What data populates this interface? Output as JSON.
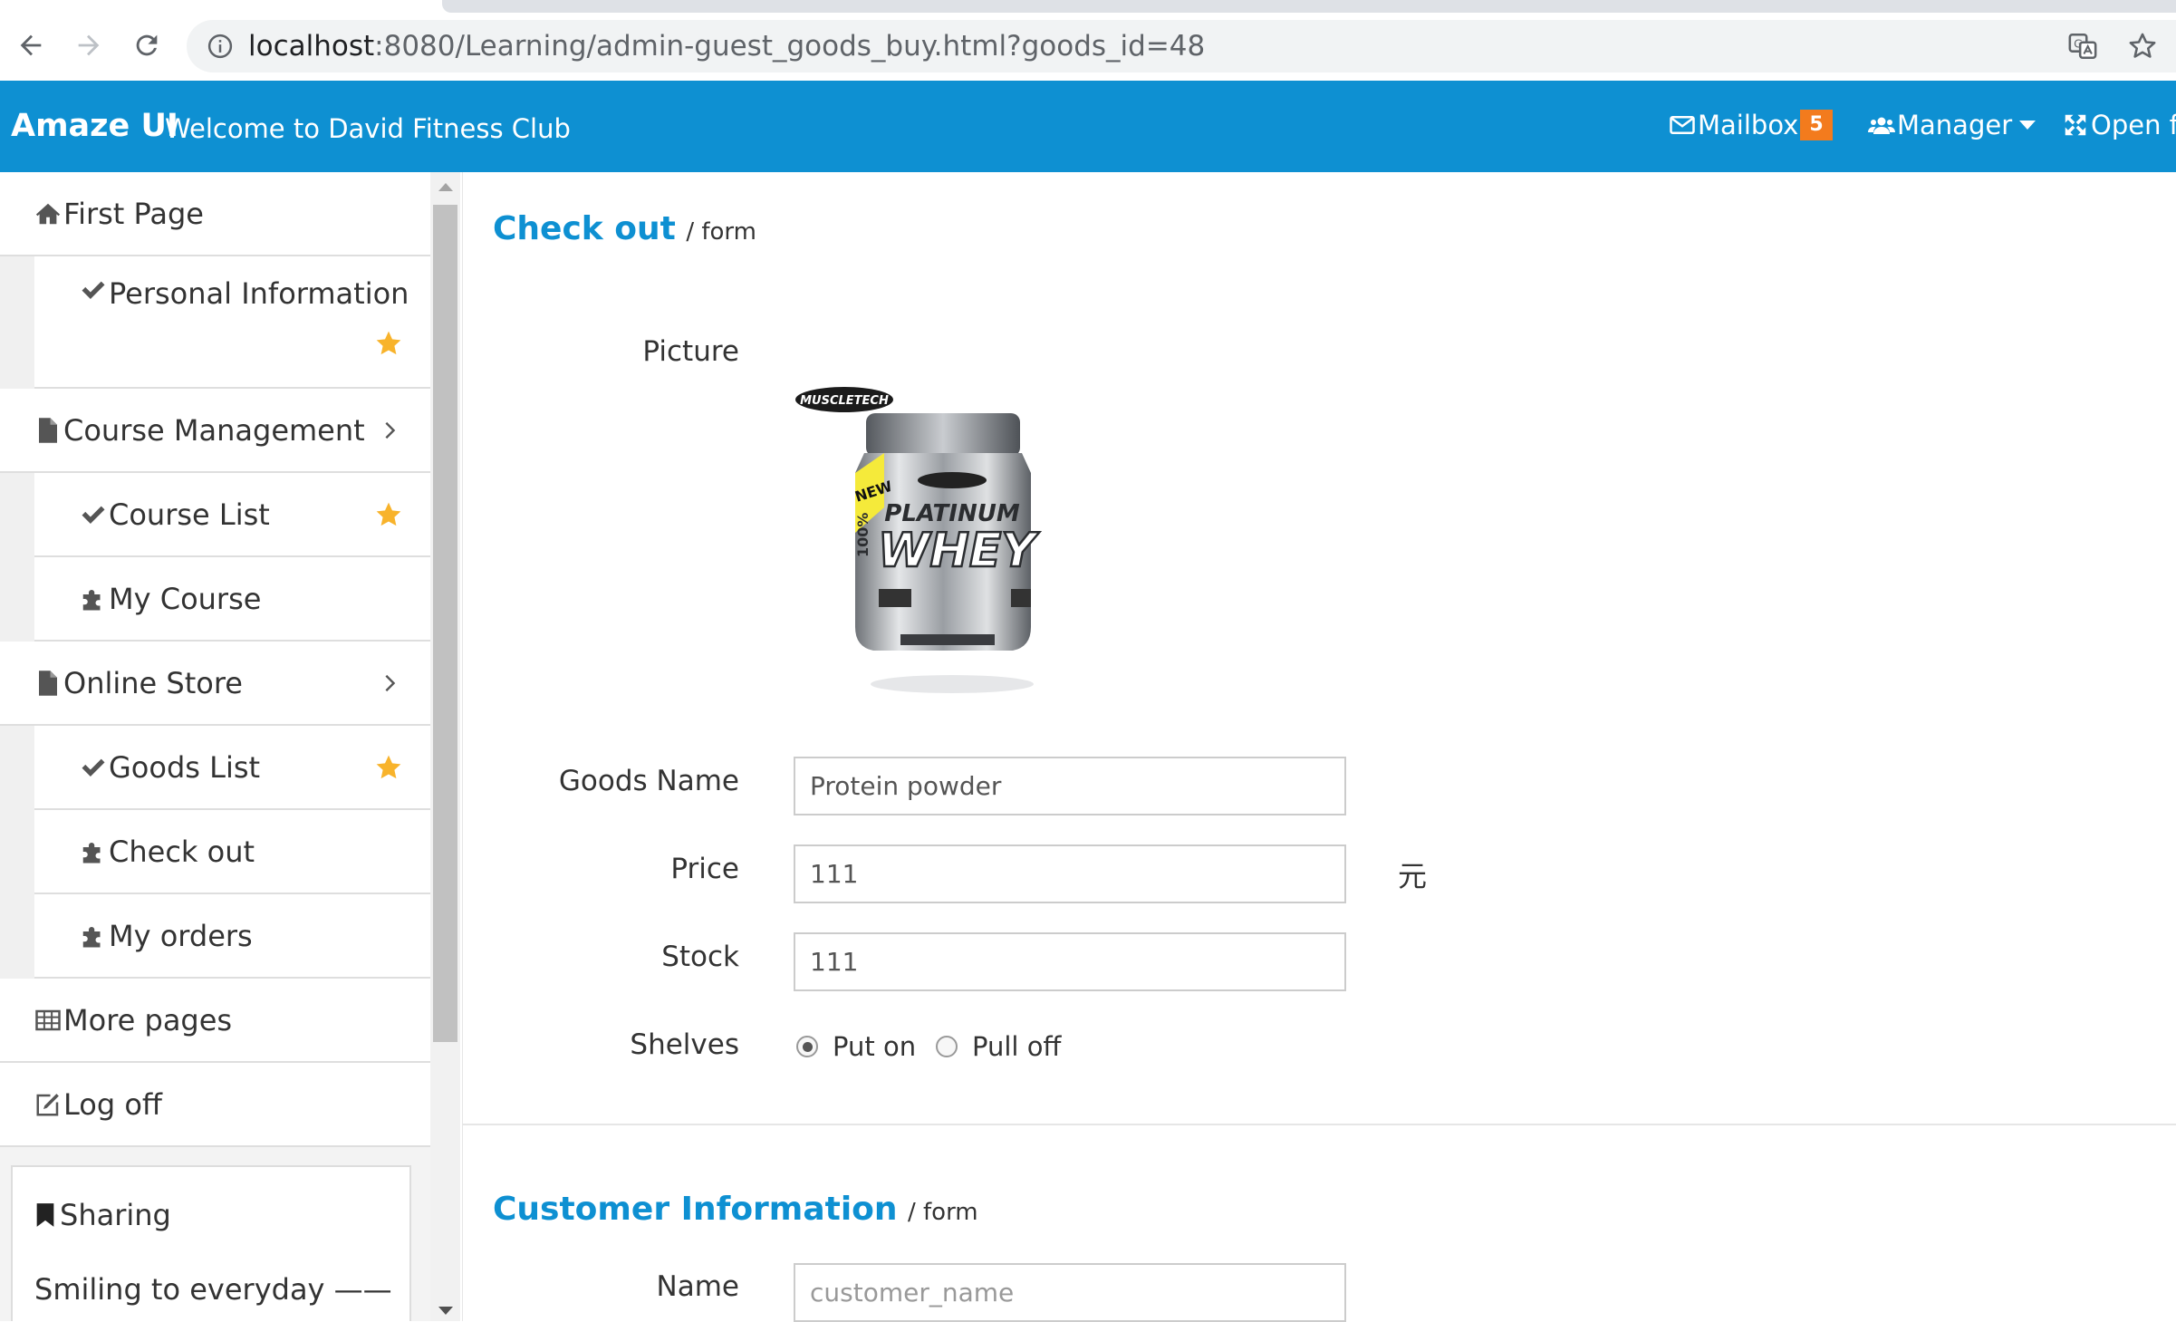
{
  "browser": {
    "url_host": "localhost",
    "url_rest": ":8080/Learning/admin-guest_goods_buy.html?goods_id=48"
  },
  "header": {
    "brand": "Amaze UI",
    "welcome": "Welcome to David Fitness Club",
    "mailbox_label": "Mailbox",
    "mailbox_count": "5",
    "manager_label": "Manager",
    "fullscreen_label": "Open fu",
    "accent_color": "#0e90d2",
    "badge_color": "#f37b1d"
  },
  "sidebar": {
    "items": [
      {
        "label": "First Page",
        "icon": "home-icon"
      },
      {
        "label": "Personal Information",
        "icon": "check-icon",
        "favorite": true
      },
      {
        "label": "Course Management",
        "icon": "file-icon",
        "expandable": true
      },
      {
        "label": "Course List",
        "icon": "check-icon",
        "favorite": true
      },
      {
        "label": "My Course",
        "icon": "puzzle-icon"
      },
      {
        "label": "Online Store",
        "icon": "file-icon",
        "expandable": true
      },
      {
        "label": "Goods List",
        "icon": "check-icon",
        "favorite": true
      },
      {
        "label": "Check out",
        "icon": "puzzle-icon"
      },
      {
        "label": "My orders",
        "icon": "puzzle-icon"
      },
      {
        "label": "More pages",
        "icon": "table-icon"
      },
      {
        "label": "Log off",
        "icon": "edit-icon"
      }
    ],
    "panel": {
      "title": "Sharing",
      "text": "Smiling to everyday ——"
    }
  },
  "checkout": {
    "title": "Check out",
    "subtitle": "/ form",
    "picture_label": "Picture",
    "product_image_text": {
      "brand": "MUSCLETECH",
      "badge": "NEW",
      "line1": "PLATINUM",
      "line2": "WHEY",
      "side": "100%"
    },
    "goods_name_label": "Goods Name",
    "goods_name_value": "Protein powder",
    "price_label": "Price",
    "price_value": "111",
    "price_unit": "元",
    "stock_label": "Stock",
    "stock_value": "111",
    "shelves_label": "Shelves",
    "shelves_options": [
      "Put on",
      "Pull off"
    ],
    "shelves_selected": "Put on"
  },
  "customer": {
    "title": "Customer Information",
    "subtitle": "/ form",
    "name_label": "Name",
    "name_placeholder": "customer_name"
  }
}
